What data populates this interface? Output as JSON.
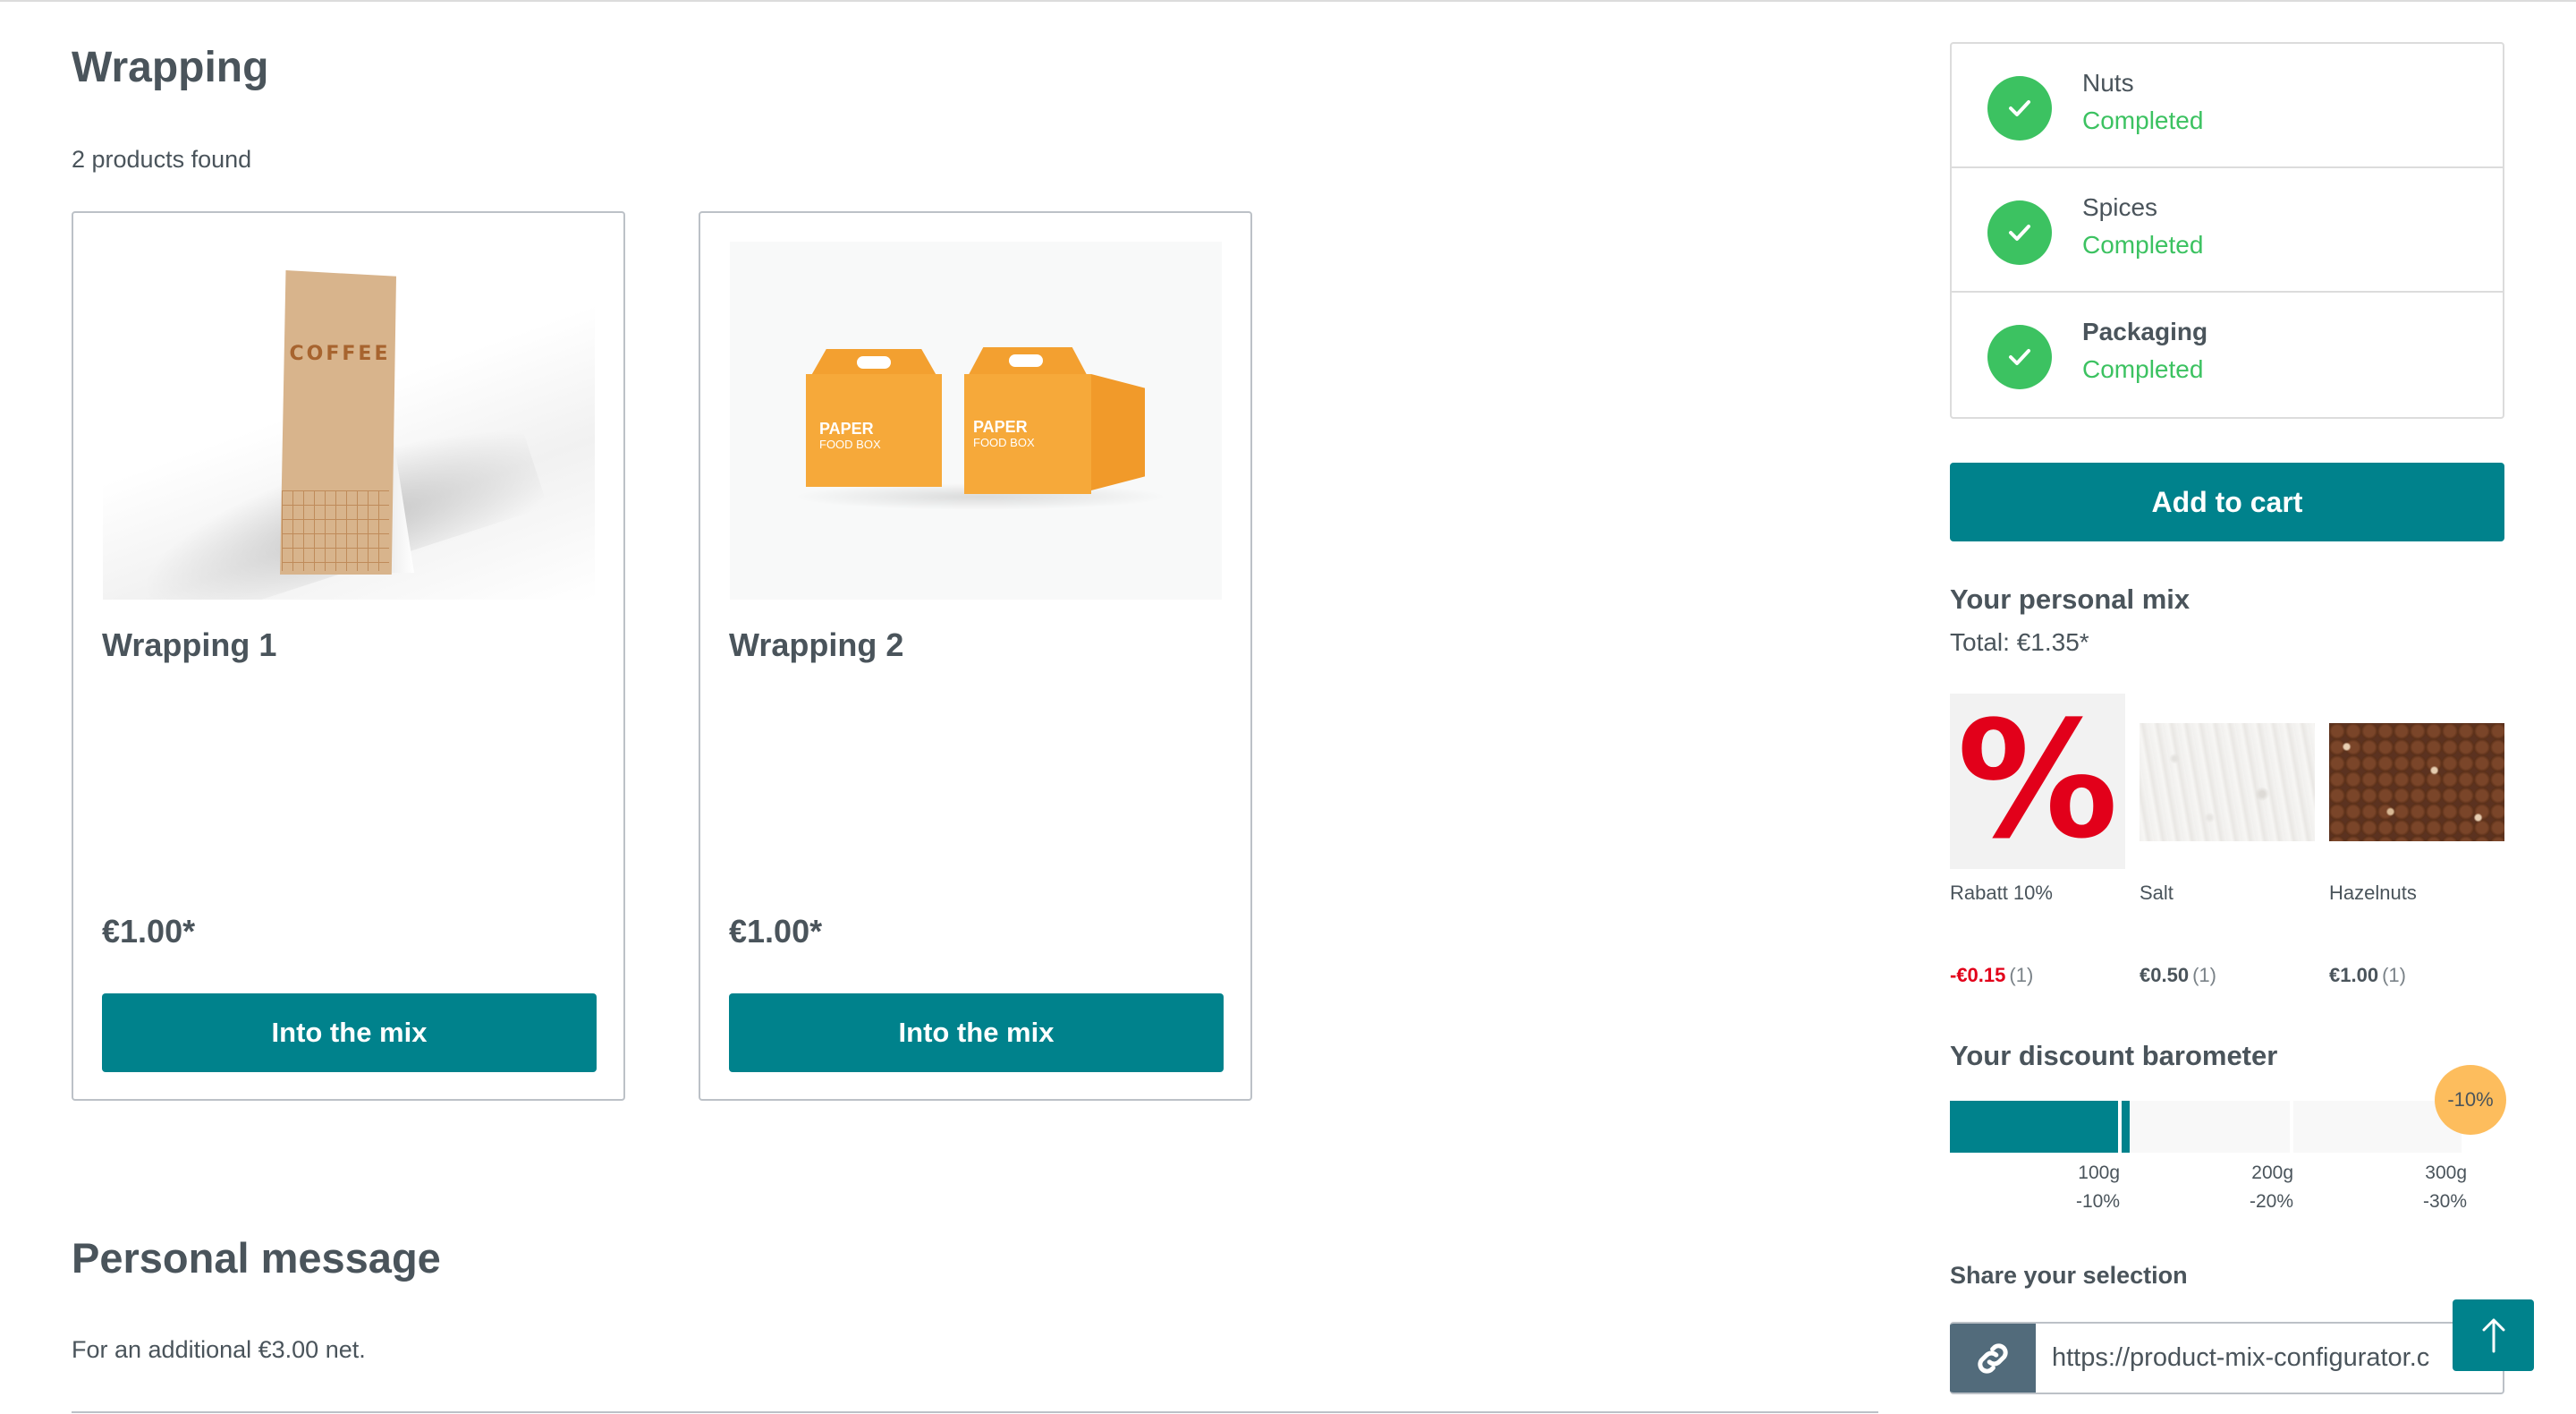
{
  "main": {
    "title": "Wrapping",
    "products_count": "2 products found",
    "products": [
      {
        "name": "Wrapping 1",
        "price": "€1.00*",
        "button_label": "Into the mix",
        "image": "coffee-bag"
      },
      {
        "name": "Wrapping 2",
        "price": "€1.00*",
        "button_label": "Into the mix",
        "image": "paper-food-box"
      }
    ],
    "personal_message": {
      "title": "Personal message",
      "subtitle": "For an additional €3.00 net."
    }
  },
  "sidebar": {
    "steps": [
      {
        "name": "Nuts",
        "status": "Completed",
        "icon": "check-icon",
        "active": false
      },
      {
        "name": "Spices",
        "status": "Completed",
        "icon": "check-icon",
        "active": false
      },
      {
        "name": "Packaging",
        "status": "Completed",
        "icon": "check-icon",
        "active": true
      }
    ],
    "add_to_cart_label": "Add to cart",
    "mix": {
      "title": "Your personal mix",
      "total": "Total: €1.35*",
      "items": [
        {
          "name": "Rabatt 10%",
          "price": "-€0.15",
          "qty": "(1)",
          "image": "percent-sign"
        },
        {
          "name": "Salt",
          "price": "€0.50",
          "qty": "(1)",
          "image": "salt"
        },
        {
          "name": "Hazelnuts",
          "price": "€1.00",
          "qty": "(1)",
          "image": "hazelnuts"
        }
      ]
    },
    "barometer": {
      "title": "Your discount barometer",
      "current_discount": "-10%",
      "current_weight_g": 105,
      "max_weight_g": 300,
      "thresholds": [
        {
          "weight": "100g",
          "discount": "-10%",
          "value_g": 100
        },
        {
          "weight": "200g",
          "discount": "-20%",
          "value_g": 200
        },
        {
          "weight": "300g",
          "discount": "-30%",
          "value_g": 300
        }
      ]
    },
    "share": {
      "title": "Share your selection",
      "url": "https://product-mix-configurator.c"
    }
  },
  "colors": {
    "primary": "#00828c",
    "success": "#3cc261",
    "discount_red": "#e2001a",
    "badge_orange": "#fdbd5d",
    "link_icon_bg": "#526b7b",
    "text": "#4a545b"
  }
}
